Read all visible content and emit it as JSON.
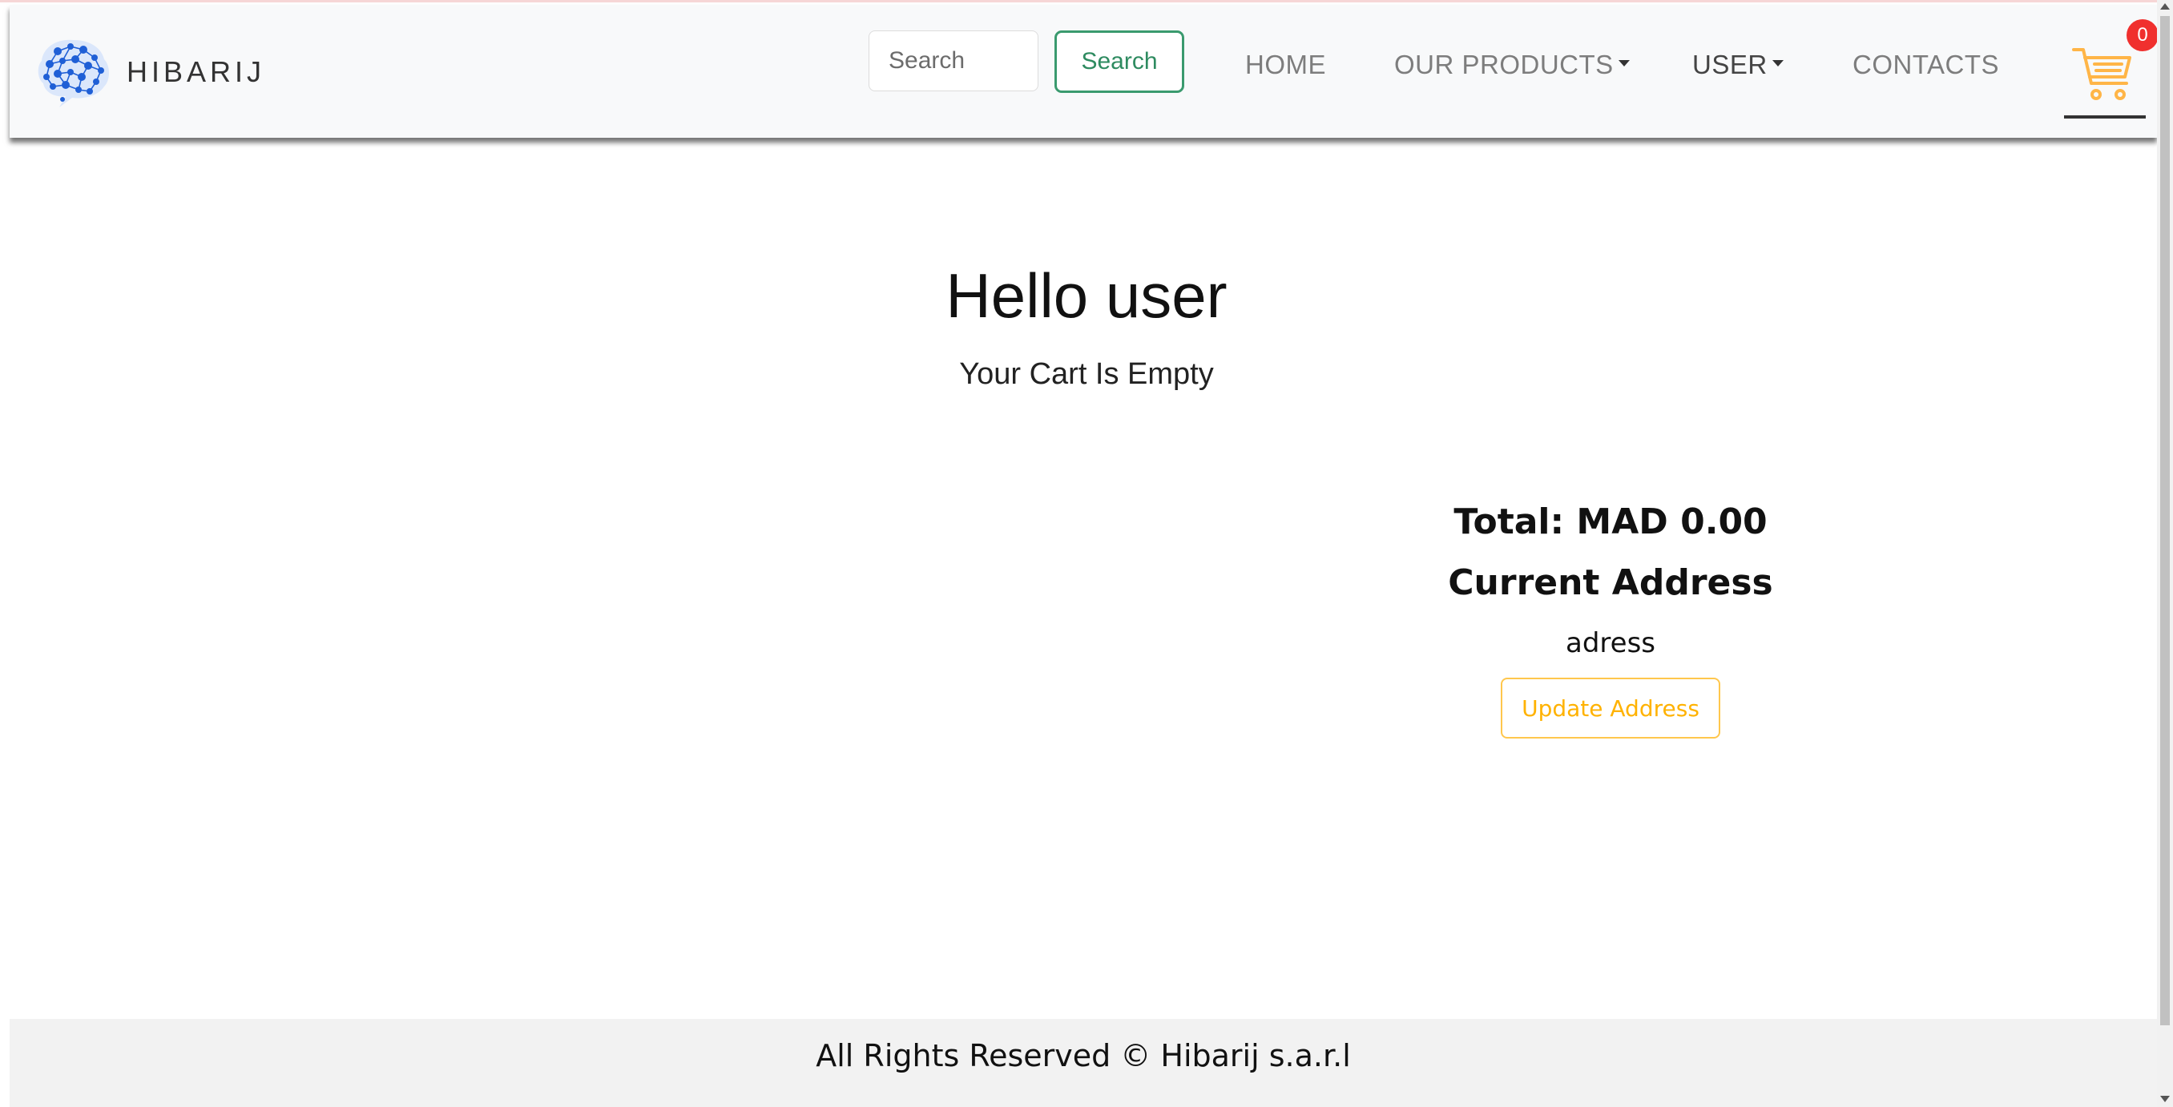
{
  "navbar": {
    "brand": {
      "name": "HIBARIJ",
      "logo_icon": "brain-network-logo"
    },
    "search": {
      "placeholder": "Search",
      "value": "",
      "button_label": "Search"
    },
    "links": {
      "home": "HOME",
      "products": "OUR PRODUCTS",
      "user": "USER",
      "contacts": "CONTACTS"
    },
    "cart": {
      "icon": "shopping-cart-icon",
      "count": "0"
    }
  },
  "main": {
    "greeting": "Hello user",
    "cart_status": "Your Cart Is Empty",
    "total_label": "Total: MAD 0.00",
    "address_heading": "Current Address",
    "address_value": "adress",
    "update_button_label": "Update Address"
  },
  "footer": {
    "text": "All Rights Reserved © Hibarij s.a.r.l"
  },
  "colors": {
    "brand_blue": "#1f5fd6",
    "search_green": "#2e8b60",
    "accent_orange": "#ffb200",
    "badge_red": "#f0302e"
  }
}
